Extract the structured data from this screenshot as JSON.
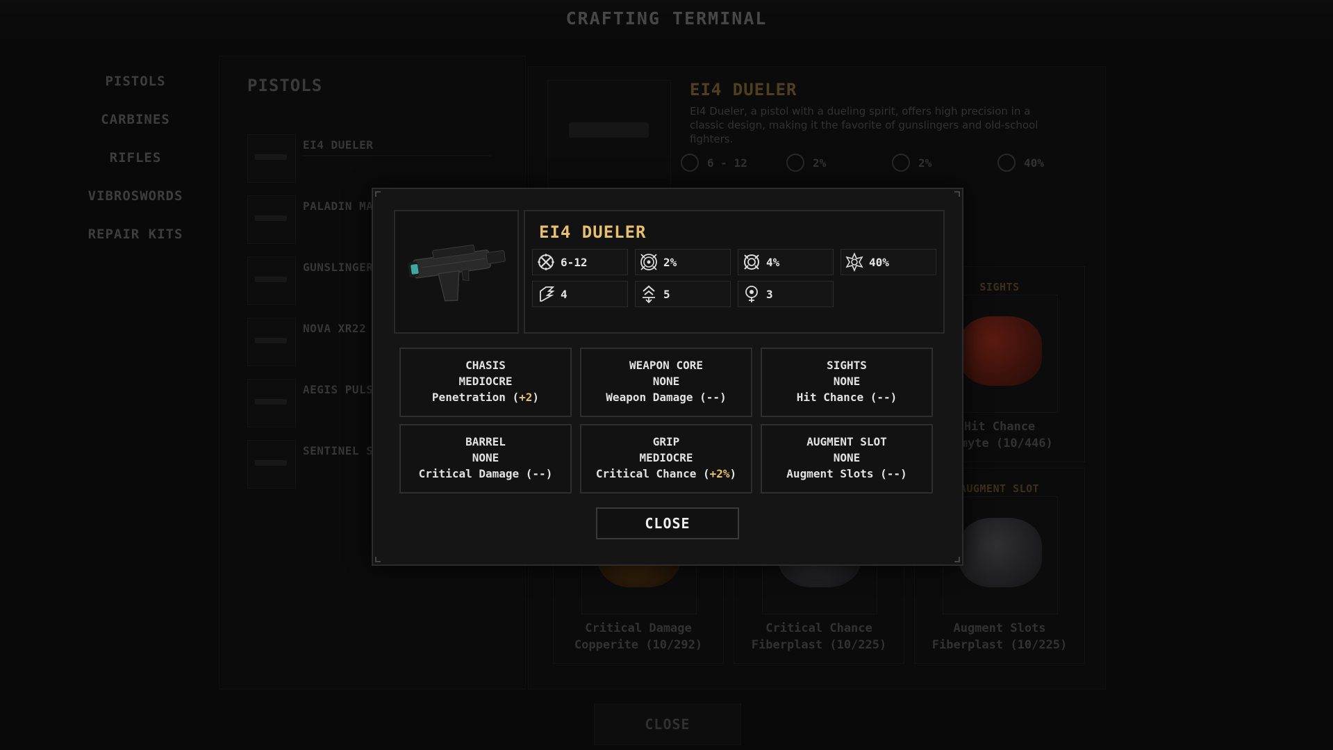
{
  "header": {
    "title": "CRAFTING TERMINAL"
  },
  "sidebar": {
    "items": [
      {
        "label": "PISTOLS"
      },
      {
        "label": "CARBINES"
      },
      {
        "label": "RIFLES"
      },
      {
        "label": "VIBROSWORDS"
      },
      {
        "label": "REPAIR KITS"
      }
    ]
  },
  "list": {
    "title": "PISTOLS",
    "items": [
      {
        "name": "EI4 DUELER"
      },
      {
        "name": "PALADIN MA"
      },
      {
        "name": "GUNSLINGER"
      },
      {
        "name": "NOVA XR22"
      },
      {
        "name": "AEGIS PULSA"
      },
      {
        "name": "SENTINEL S4"
      }
    ]
  },
  "detail": {
    "title": "EI4 DUELER",
    "description": "EI4 Dueler, a pistol with a dueling spirit, offers high precision in a classic design, making it the favorite of gunslingers and old-school fighters.",
    "stats": [
      {
        "icon": "damage-icon",
        "value": "6 - 12"
      },
      {
        "icon": "critical-chance-icon",
        "value": "2%"
      },
      {
        "icon": "hit-chance-icon",
        "value": "2%"
      },
      {
        "icon": "critical-damage-icon",
        "value": "40%"
      }
    ],
    "cards": [
      {
        "slot": "SIGHTS",
        "stat": "Hit Chance",
        "material": "ismyte (10/446)",
        "color": "#6a1f14"
      },
      {
        "slot": "AUGMENT SLOT",
        "stat": "Augment Slots",
        "material": "Fiberplast (10/225)",
        "color": "#3b3b3d"
      },
      {
        "slot": "",
        "stat": "Critical Damage",
        "material": "Copperite (10/292)",
        "color": "#5a3a12"
      },
      {
        "slot": "",
        "stat": "Critical Chance",
        "material": "Fiberplast (10/225)",
        "color": "#3b3b3d"
      }
    ],
    "close_label": "CLOSE"
  },
  "modal": {
    "title": "EI4 DUELER",
    "stats": [
      {
        "icon": "damage-icon",
        "value": "6-12"
      },
      {
        "icon": "critical-chance-icon",
        "value": "2%"
      },
      {
        "icon": "hit-chance-icon",
        "value": "4%"
      },
      {
        "icon": "critical-damage-icon",
        "value": "40%"
      },
      {
        "icon": "penetration-icon",
        "value": "4"
      },
      {
        "icon": "range-icon",
        "value": "5"
      },
      {
        "icon": "augment-slots-icon",
        "value": "3"
      }
    ],
    "parts": [
      {
        "name": "CHASIS",
        "quality": "MEDIOCRE",
        "stat": "Penetration",
        "bonus": "+2"
      },
      {
        "name": "WEAPON CORE",
        "quality": "NONE",
        "stat": "Weapon Damage",
        "bonus": "--"
      },
      {
        "name": "SIGHTS",
        "quality": "NONE",
        "stat": "Hit Chance",
        "bonus": "--"
      },
      {
        "name": "BARREL",
        "quality": "NONE",
        "stat": "Critical Damage",
        "bonus": "--"
      },
      {
        "name": "GRIP",
        "quality": "MEDIOCRE",
        "stat": "Critical Chance",
        "bonus": "+2%"
      },
      {
        "name": "AUGMENT SLOT",
        "quality": "NONE",
        "stat": "Augment Slots",
        "bonus": "--"
      }
    ],
    "close_label": "CLOSE",
    "colors": {
      "accent": "#e7c06e",
      "text": "#e2e2e2",
      "border": "#2e2e2e"
    }
  }
}
